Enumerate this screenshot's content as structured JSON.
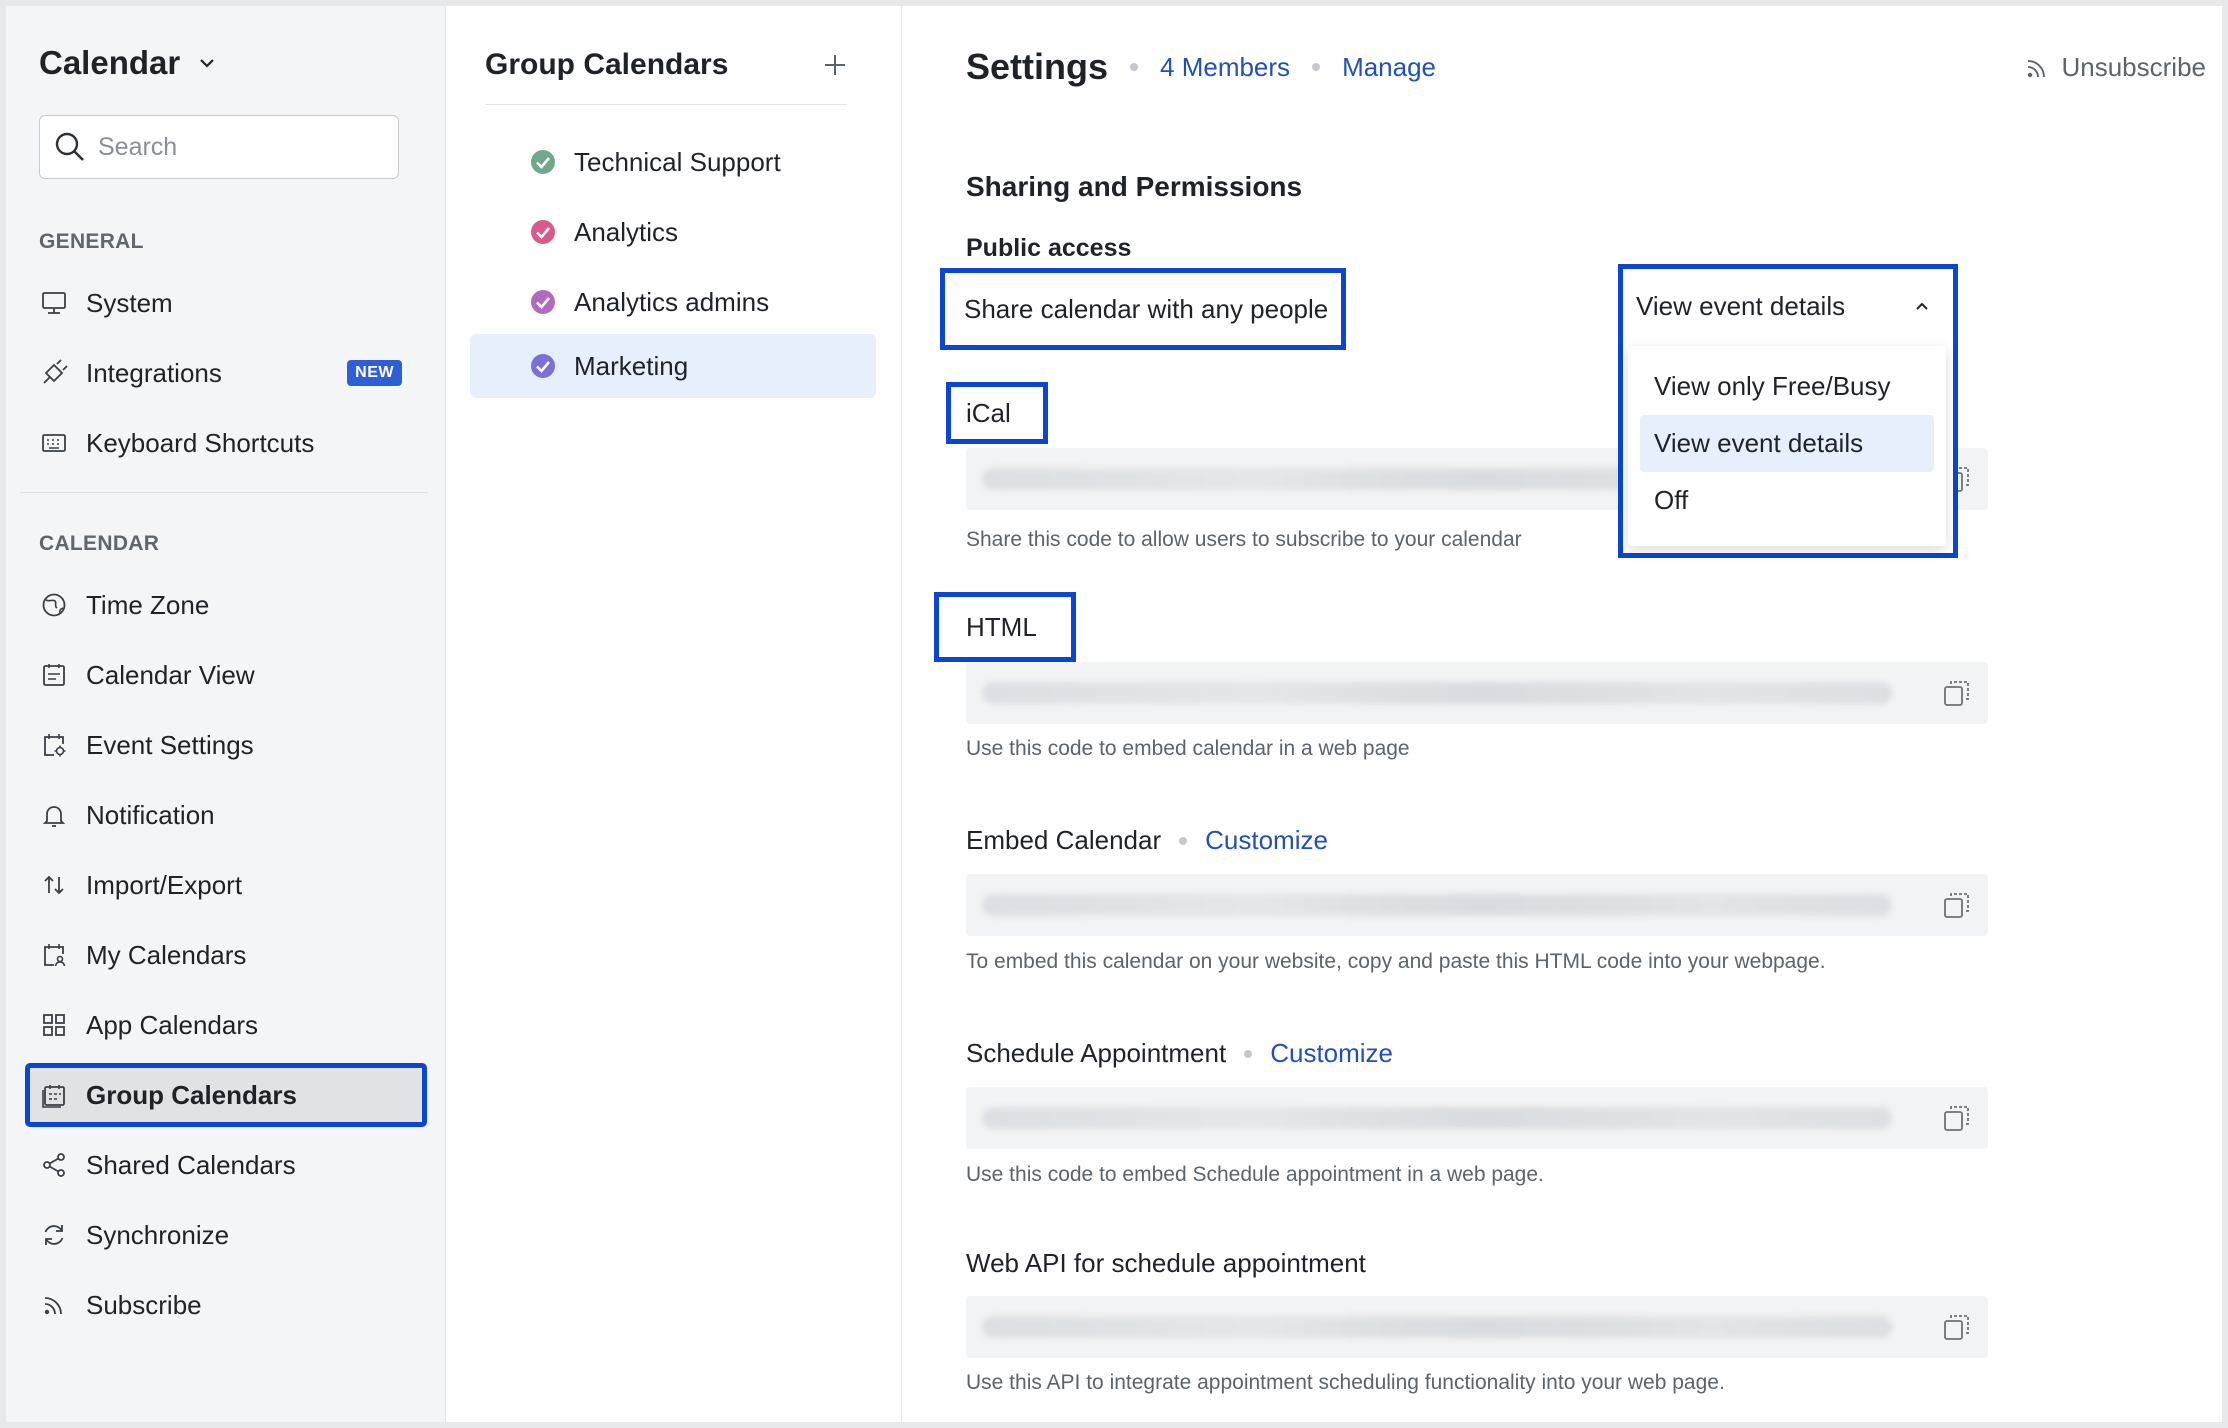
{
  "app": {
    "title": "Calendar"
  },
  "search": {
    "placeholder": "Search"
  },
  "sidebar": {
    "general_label": "GENERAL",
    "calendar_label": "CALENDAR",
    "general_items": [
      {
        "label": "System",
        "icon": "monitor-icon"
      },
      {
        "label": "Integrations",
        "icon": "plug-icon",
        "badge": "NEW"
      },
      {
        "label": "Keyboard Shortcuts",
        "icon": "keyboard-icon"
      }
    ],
    "calendar_items": [
      {
        "label": "Time Zone",
        "icon": "globe-icon"
      },
      {
        "label": "Calendar View",
        "icon": "calendar-view-icon"
      },
      {
        "label": "Event Settings",
        "icon": "event-settings-icon"
      },
      {
        "label": "Notification",
        "icon": "bell-icon"
      },
      {
        "label": "Import/Export",
        "icon": "import-export-icon"
      },
      {
        "label": "My Calendars",
        "icon": "my-calendars-icon"
      },
      {
        "label": "App Calendars",
        "icon": "app-grid-icon"
      },
      {
        "label": "Group Calendars",
        "icon": "group-calendar-icon",
        "active": true
      },
      {
        "label": "Shared Calendars",
        "icon": "share-icon"
      },
      {
        "label": "Synchronize",
        "icon": "sync-icon"
      },
      {
        "label": "Subscribe",
        "icon": "rss-icon"
      }
    ]
  },
  "groups": {
    "title": "Group Calendars",
    "items": [
      {
        "label": "Technical Support",
        "color": "#6fa88a"
      },
      {
        "label": "Analytics",
        "color": "#d9598a"
      },
      {
        "label": "Analytics admins",
        "color": "#b469c0"
      },
      {
        "label": "Marketing",
        "color": "#7b6fd9",
        "selected": true
      }
    ]
  },
  "main": {
    "title": "Settings",
    "members_link": "4 Members",
    "manage_link": "Manage",
    "unsubscribe": "Unsubscribe",
    "section_title": "Sharing and Permissions",
    "public_access": "Public access",
    "share_label": "Share calendar with any people",
    "dropdown": {
      "selected": "View event details",
      "options": [
        "View only Free/Busy",
        "View event details",
        "Off"
      ]
    },
    "ical": {
      "label": "iCal",
      "hint": "Share this code to allow users to subscribe to your calendar"
    },
    "html": {
      "label": "HTML",
      "hint": "Use this code to embed calendar in a web page"
    },
    "embed": {
      "label": "Embed Calendar",
      "link": "Customize",
      "hint": "To embed this calendar on your website, copy and paste this HTML code into your webpage."
    },
    "schedule": {
      "label": "Schedule Appointment",
      "link": "Customize",
      "hint": "Use this code to embed Schedule appointment in a web page."
    },
    "webapi": {
      "label": "Web API for schedule appointment",
      "hint": "Use this API to integrate appointment scheduling functionality into your web page."
    }
  },
  "colors": {
    "accent": "#2150b8",
    "highlight": "#0a46d1",
    "selection": "#e8effc"
  }
}
